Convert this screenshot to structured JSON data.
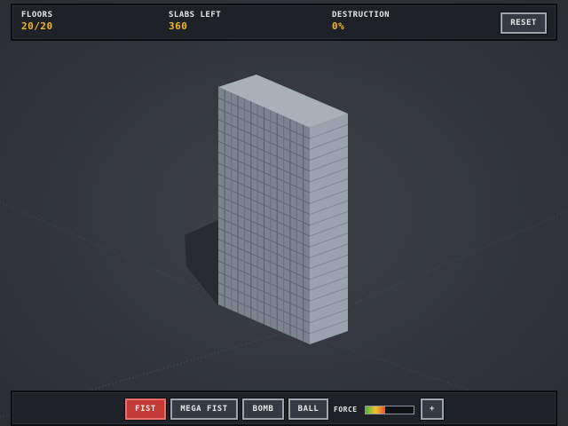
{
  "hud": {
    "floors_label": "FLOORS",
    "floors_value": "20/20",
    "slabs_label": "SLABS LEFT",
    "slabs_value": "360",
    "destruction_label": "DESTRUCTION",
    "destruction_value": "0%",
    "reset_label": "RESET"
  },
  "toolbar": {
    "tools": [
      {
        "label": "FIST",
        "active": true
      },
      {
        "label": "MEGA FIST",
        "active": false
      },
      {
        "label": "BOMB",
        "active": false
      },
      {
        "label": "BALL",
        "active": false
      }
    ],
    "force_label": "FORCE",
    "force_level": 0.4,
    "plus_label": "+"
  },
  "building": {
    "floors": 20
  },
  "colors": {
    "accent": "#f2b62b",
    "active_tool": "#c23a35",
    "building_face": "#8b939e",
    "background": "#33363e"
  }
}
